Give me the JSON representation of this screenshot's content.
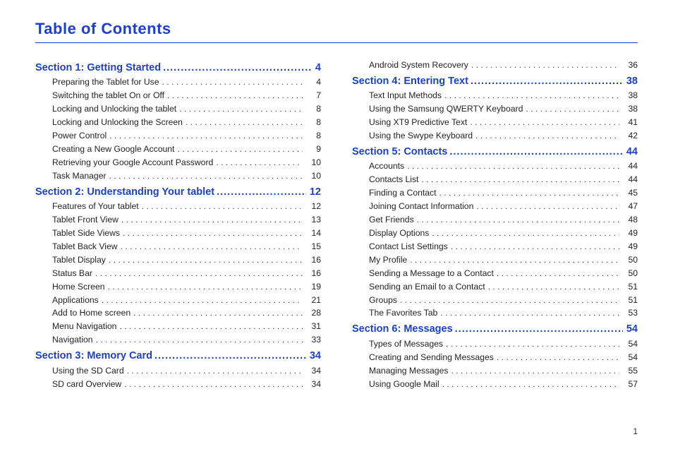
{
  "title": "Table of Contents",
  "page_number": "1",
  "columns": [
    [
      {
        "type": "section",
        "label": "Section 1:  Getting Started",
        "page": "4"
      },
      {
        "type": "entry",
        "label": "Preparing the Tablet for Use",
        "page": "4"
      },
      {
        "type": "entry",
        "label": "Switching the tablet On or Off",
        "page": "7"
      },
      {
        "type": "entry",
        "label": "Locking and Unlocking the tablet",
        "page": "8"
      },
      {
        "type": "entry",
        "label": "Locking and Unlocking the Screen",
        "page": "8"
      },
      {
        "type": "entry",
        "label": "Power Control",
        "page": "8"
      },
      {
        "type": "entry",
        "label": "Creating a New Google Account",
        "page": "9"
      },
      {
        "type": "entry",
        "label": "Retrieving your Google Account Password",
        "page": "10"
      },
      {
        "type": "entry",
        "label": "Task Manager",
        "page": "10"
      },
      {
        "type": "section",
        "label": "Section 2:  Understanding Your tablet",
        "page": "12"
      },
      {
        "type": "entry",
        "label": "Features of Your tablet",
        "page": "12"
      },
      {
        "type": "entry",
        "label": "Tablet Front View",
        "page": "13"
      },
      {
        "type": "entry",
        "label": "Tablet Side Views",
        "page": "14"
      },
      {
        "type": "entry",
        "label": "Tablet Back View",
        "page": "15"
      },
      {
        "type": "entry",
        "label": "Tablet Display",
        "page": "16"
      },
      {
        "type": "entry",
        "label": "Status Bar",
        "page": "16"
      },
      {
        "type": "entry",
        "label": "Home Screen",
        "page": "19"
      },
      {
        "type": "entry",
        "label": "Applications",
        "page": "21"
      },
      {
        "type": "entry",
        "label": "Add to Home screen",
        "page": "28"
      },
      {
        "type": "entry",
        "label": "Menu Navigation",
        "page": "31"
      },
      {
        "type": "entry",
        "label": "Navigation",
        "page": "33"
      },
      {
        "type": "section",
        "label": "Section 3:  Memory Card",
        "page": "34"
      },
      {
        "type": "entry",
        "label": "Using the SD Card",
        "page": "34"
      },
      {
        "type": "entry",
        "label": "SD card Overview",
        "page": "34"
      }
    ],
    [
      {
        "type": "entry",
        "label": "Android System Recovery",
        "page": "36"
      },
      {
        "type": "section",
        "label": "Section 4:  Entering Text",
        "page": "38"
      },
      {
        "type": "entry",
        "label": "Text Input Methods",
        "page": "38"
      },
      {
        "type": "entry",
        "label": "Using the Samsung QWERTY Keyboard",
        "page": "38"
      },
      {
        "type": "entry",
        "label": "Using XT9 Predictive Text",
        "page": "41"
      },
      {
        "type": "entry",
        "label": "Using the Swype Keyboard",
        "page": "42"
      },
      {
        "type": "section",
        "label": "Section 5:  Contacts",
        "page": "44"
      },
      {
        "type": "entry",
        "label": "Accounts",
        "page": "44"
      },
      {
        "type": "entry",
        "label": "Contacts List",
        "page": "44"
      },
      {
        "type": "entry",
        "label": "Finding a Contact",
        "page": "45"
      },
      {
        "type": "entry",
        "label": "Joining Contact Information",
        "page": "47"
      },
      {
        "type": "entry",
        "label": "Get Friends",
        "page": "48"
      },
      {
        "type": "entry",
        "label": "Display Options",
        "page": "49"
      },
      {
        "type": "entry",
        "label": "Contact List Settings",
        "page": "49"
      },
      {
        "type": "entry",
        "label": "My Profile",
        "page": "50"
      },
      {
        "type": "entry",
        "label": "Sending a Message to a Contact",
        "page": "50"
      },
      {
        "type": "entry",
        "label": "Sending an Email to a Contact",
        "page": "51"
      },
      {
        "type": "entry",
        "label": "Groups",
        "page": "51"
      },
      {
        "type": "entry",
        "label": "The Favorites Tab",
        "page": "53"
      },
      {
        "type": "section",
        "label": "Section 6:  Messages",
        "page": "54"
      },
      {
        "type": "entry",
        "label": "Types of Messages",
        "page": "54"
      },
      {
        "type": "entry",
        "label": "Creating and Sending Messages",
        "page": "54"
      },
      {
        "type": "entry",
        "label": "Managing Messages",
        "page": "55"
      },
      {
        "type": "entry",
        "label": "Using Google Mail",
        "page": "57"
      }
    ]
  ]
}
